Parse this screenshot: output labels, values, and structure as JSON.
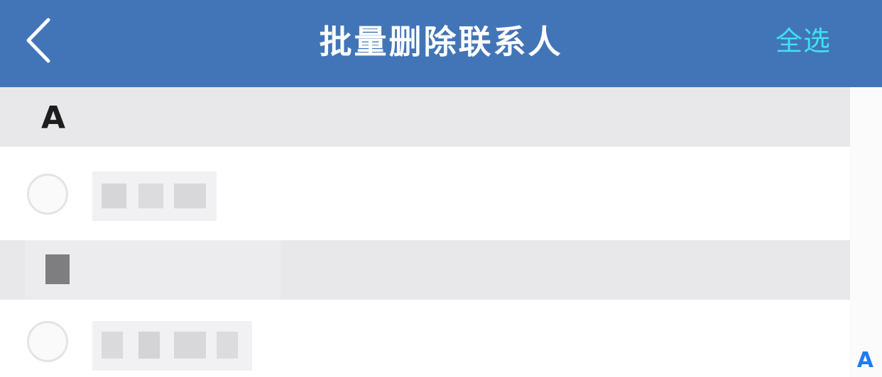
{
  "navbar": {
    "title": "批量删除联系人",
    "select_all_label": "全选",
    "back_icon": "chevron-left-icon",
    "background_color": "#4275b7",
    "accent_color": "#3fe0f0"
  },
  "sections": [
    {
      "letter": "A"
    }
  ],
  "index_bar": {
    "letters": [
      "A"
    ],
    "color": "#1d7cf2"
  }
}
